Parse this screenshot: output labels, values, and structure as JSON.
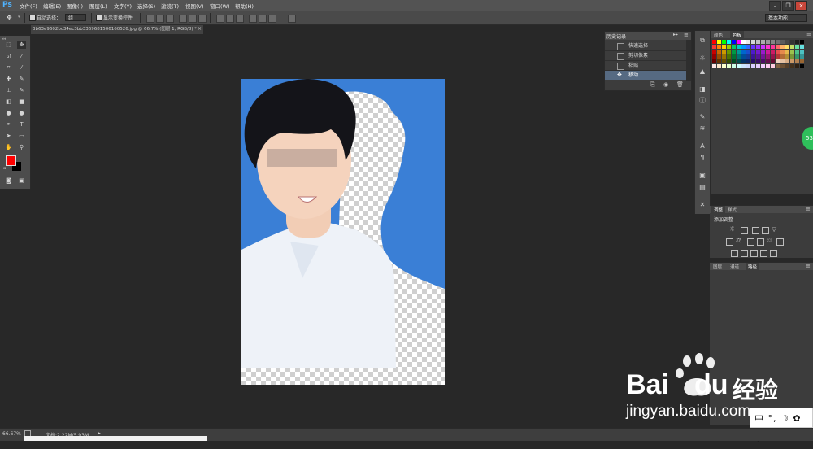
{
  "app": {
    "logo": "Ps"
  },
  "menubar": {
    "items": [
      "文件(F)",
      "编辑(E)",
      "图像(I)",
      "图层(L)",
      "文字(Y)",
      "选择(S)",
      "滤镜(T)",
      "视图(V)",
      "窗口(W)",
      "帮助(H)"
    ],
    "window_buttons": [
      "–",
      "❐",
      "×"
    ]
  },
  "options": {
    "auto_select_label": "自动选择：",
    "auto_select_value": "组",
    "show_transform_label": "显示变换控件",
    "workspace": "基本功能"
  },
  "document": {
    "tab_title": "3b63e9602bc34ec3bb3369681506160526.jpg @ 66.7% (图层 1, RGB/8) *",
    "close": "×"
  },
  "history": {
    "tab": "历史记录",
    "items": [
      {
        "label": "快速选择",
        "active": false
      },
      {
        "label": "剪切像素",
        "active": false
      },
      {
        "label": "粘贴",
        "active": false
      },
      {
        "label": "移动",
        "active": true
      }
    ]
  },
  "swatches": {
    "tabs": [
      "颜色",
      "色板"
    ],
    "active_tab": "色板"
  },
  "adjustments": {
    "tabs": [
      "调整",
      "样式"
    ],
    "title": "添加调整"
  },
  "paths": {
    "tabs": [
      "图层",
      "通道",
      "路径"
    ],
    "active_tab": "路径"
  },
  "status": {
    "zoom": "66.67%",
    "doc_info": "文档:2.22M/5.93M"
  },
  "watermark": {
    "brand_bai": "Bai",
    "brand_du": "du",
    "brand_jy": "经验",
    "url": "jingyan.baidu.com"
  },
  "ime": {
    "text": "中 °, ☽ ✿ ☂"
  },
  "badge": {
    "text": "53"
  },
  "colors": {
    "foreground": "#ff0000",
    "background": "#000000",
    "canvas_bg": "#3a7fd6",
    "history_active": "#566a82",
    "accent": "#4fb3ff"
  }
}
